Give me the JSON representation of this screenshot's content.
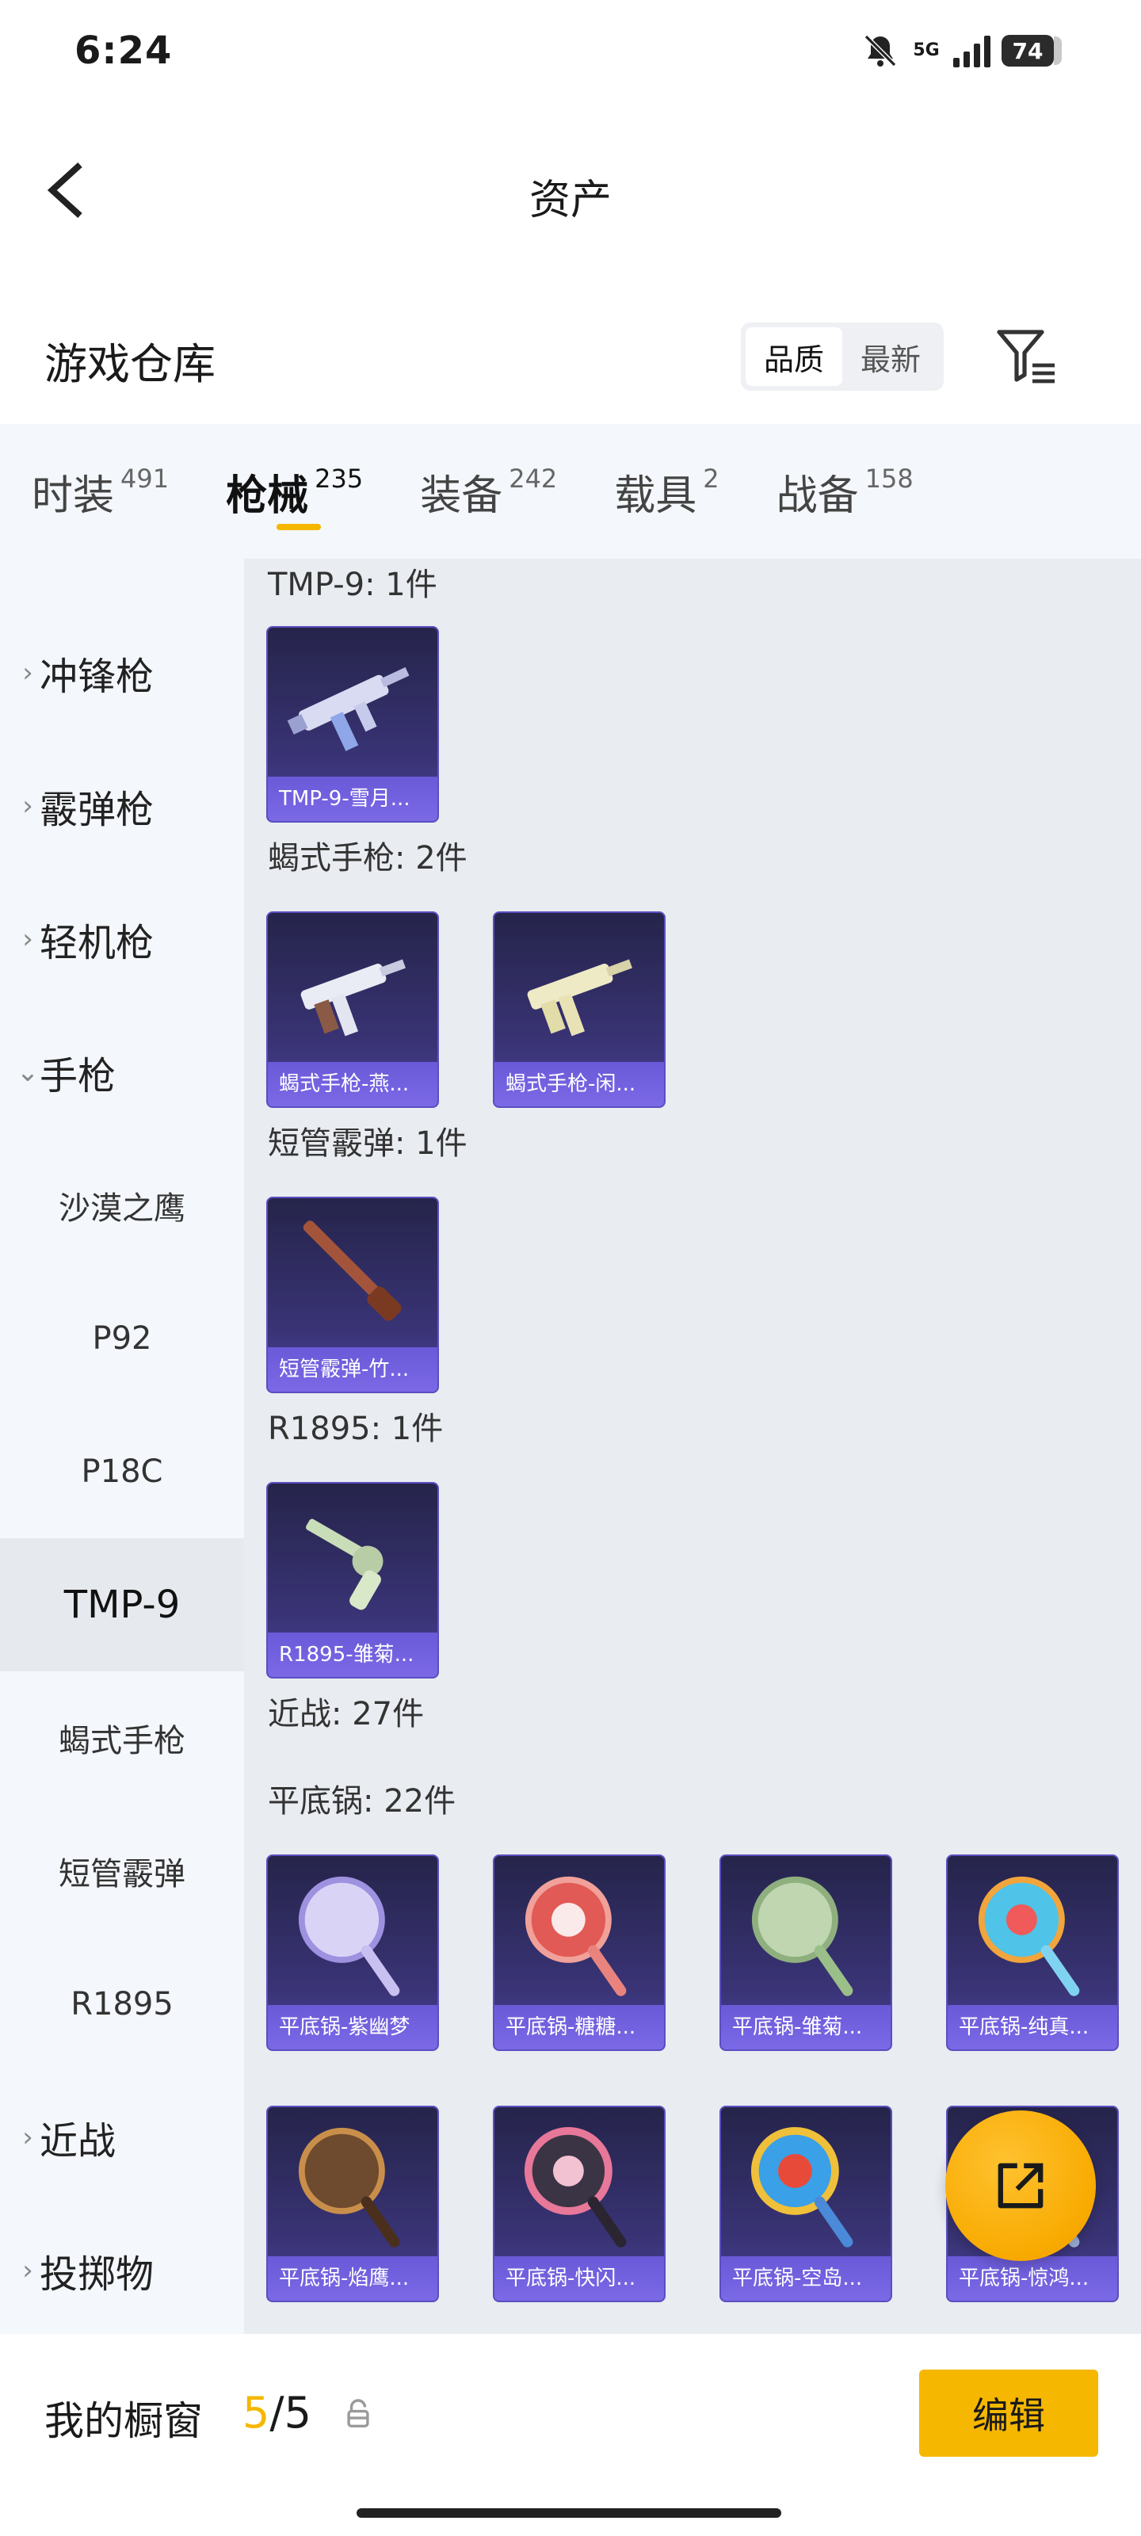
{
  "status_bar": {
    "time": "6:24",
    "network": "5G",
    "battery": "74"
  },
  "header": {
    "title": "资产"
  },
  "section": {
    "title": "游戏仓库",
    "sort_options": [
      "品质",
      "最新"
    ],
    "sort_selected": "品质"
  },
  "tabs": [
    {
      "label": "时装",
      "count": "491"
    },
    {
      "label": "枪械",
      "count": "235",
      "active": true
    },
    {
      "label": "装备",
      "count": "242"
    },
    {
      "label": "载具",
      "count": "2"
    },
    {
      "label": "战备",
      "count": "158"
    }
  ],
  "sidebar": {
    "items": [
      {
        "label": "冲锋枪",
        "kind": "category",
        "expanded": false
      },
      {
        "label": "霰弹枪",
        "kind": "category",
        "expanded": false
      },
      {
        "label": "轻机枪",
        "kind": "category",
        "expanded": false
      },
      {
        "label": "手枪",
        "kind": "category",
        "expanded": true
      },
      {
        "label": "沙漠之鹰",
        "kind": "sub"
      },
      {
        "label": "P92",
        "kind": "sub"
      },
      {
        "label": "P18C",
        "kind": "sub"
      },
      {
        "label": "TMP-9",
        "kind": "sub",
        "active": true
      },
      {
        "label": "蝎式手枪",
        "kind": "sub"
      },
      {
        "label": "短管霰弹",
        "kind": "sub"
      },
      {
        "label": "R1895",
        "kind": "sub"
      },
      {
        "label": "近战",
        "kind": "category",
        "expanded": false
      },
      {
        "label": "投掷物",
        "kind": "category",
        "expanded": false
      }
    ]
  },
  "groups": [
    {
      "title": "TMP-9: 1件",
      "items": [
        {
          "name": "TMP-9-雪月...",
          "icon": "smg-icon"
        }
      ]
    },
    {
      "title": "蝎式手枪: 2件",
      "items": [
        {
          "name": "蝎式手枪-燕...",
          "icon": "smg-icon"
        },
        {
          "name": "蝎式手枪-闲...",
          "icon": "smg-icon"
        }
      ]
    },
    {
      "title": "短管霰弹: 1件",
      "items": [
        {
          "name": "短管霰弹-竹...",
          "icon": "shotgun-icon"
        }
      ]
    },
    {
      "title": "R1895: 1件",
      "items": [
        {
          "name": "R1895-雏菊...",
          "icon": "revolver-icon"
        }
      ]
    },
    {
      "title": "近战: 27件",
      "items": []
    },
    {
      "title": "平底锅: 22件",
      "items": [
        {
          "name": "平底锅-紫幽梦",
          "icon": "pan-icon"
        },
        {
          "name": "平底锅-糖糖...",
          "icon": "pan-icon"
        },
        {
          "name": "平底锅-雏菊...",
          "icon": "pan-icon"
        },
        {
          "name": "平底锅-纯真...",
          "icon": "pan-icon"
        },
        {
          "name": "平底锅-焰鹰...",
          "icon": "pan-icon"
        },
        {
          "name": "平底锅-快闪...",
          "icon": "pan-icon"
        },
        {
          "name": "平底锅-空岛...",
          "icon": "pan-icon"
        },
        {
          "name": "平底锅-惊鸿...",
          "icon": "pan-icon"
        }
      ]
    }
  ],
  "fab": {
    "icon": "share-external-icon"
  },
  "bottom_bar": {
    "label": "我的橱窗",
    "current": "5",
    "total": "5",
    "separator": "/",
    "edit_label": "编辑"
  },
  "colors": {
    "accent": "#f5b700",
    "card_bg": "#3a3477",
    "card_caption": "#7b69e6",
    "content_bg": "#e9ecf1",
    "sidebar_bg": "#f4f7fb"
  }
}
